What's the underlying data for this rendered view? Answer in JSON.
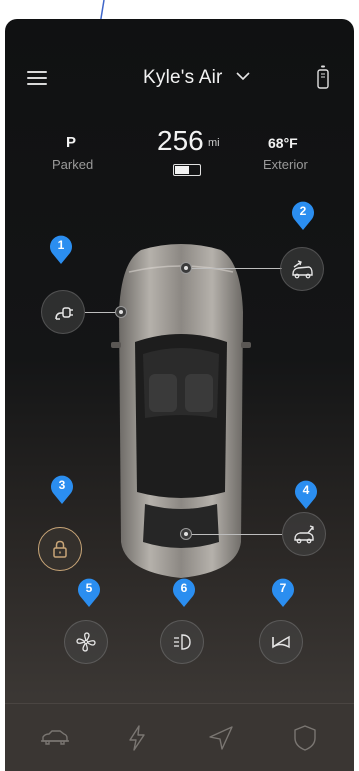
{
  "header": {
    "vehicle_name": "Kyle's Air"
  },
  "status": {
    "gear": "P",
    "gear_label": "Parked",
    "range_value": "256",
    "range_unit": "mi",
    "battery_level": 0.6,
    "temperature": "68°F",
    "temperature_label": "Exterior"
  },
  "markers": [
    "1",
    "2",
    "3",
    "4",
    "5",
    "6",
    "7"
  ],
  "controls": [
    {
      "id": "charge-port",
      "icon": "charge-port-icon"
    },
    {
      "id": "frunk",
      "icon": "frunk-open-icon"
    },
    {
      "id": "lock",
      "icon": "lock-icon"
    },
    {
      "id": "trunk",
      "icon": "trunk-open-icon"
    },
    {
      "id": "climate",
      "icon": "fan-icon"
    },
    {
      "id": "headlights",
      "icon": "headlight-icon"
    },
    {
      "id": "horn",
      "icon": "horn-icon"
    }
  ],
  "tabs": [
    "car-icon",
    "bolt-icon",
    "navigation-icon",
    "shield-icon"
  ],
  "colors": {
    "marker": "#2b8ef0",
    "lock_accent": "#c9a678",
    "background": "#141516"
  }
}
